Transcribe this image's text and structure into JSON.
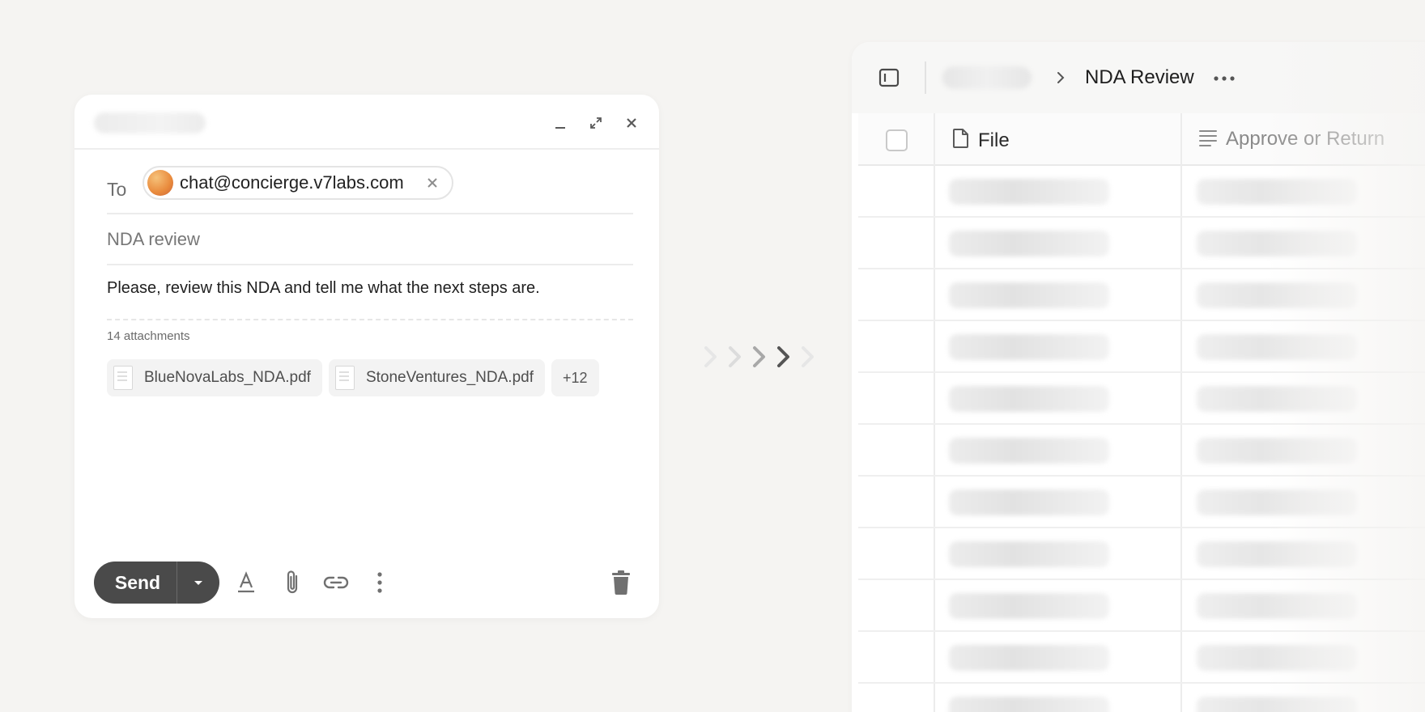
{
  "compose": {
    "to_label": "To",
    "recipient_email": "chat@concierge.v7labs.com",
    "subject": "NDA review",
    "body": "Please, review this NDA and tell me what the next steps are.",
    "attachments_count_label": "14 attachments",
    "attachments": [
      {
        "name": "BlueNovaLabs_NDA.pdf"
      },
      {
        "name": "StoneVentures_NDA.pdf"
      }
    ],
    "more_attachments": "+12",
    "send_label": "Send",
    "icons": {
      "minimize": "minimize-icon",
      "expand": "expand-icon",
      "close": "close-icon",
      "remove_recipient": "remove-recipient-icon",
      "formatting": "text-format-icon",
      "attach": "paperclip-icon",
      "link": "link-icon",
      "more": "more-vertical-icon",
      "discard": "trash-icon",
      "send_options": "caret-down-icon"
    }
  },
  "arrows": {
    "count": 5,
    "colors": [
      "#e6e6e6",
      "#dcdcdc",
      "#a8a8a8",
      "#555555",
      "#e6e6e6"
    ]
  },
  "table_panel": {
    "breadcrumb_title": "NDA Review",
    "columns": [
      {
        "label": "File",
        "icon": "file-icon"
      },
      {
        "label": "Approve or Return",
        "icon": "text-lines-icon"
      }
    ],
    "placeholder_row_count": 11,
    "icons": {
      "sidebar_toggle": "sidebar-toggle-icon",
      "breadcrumb_separator": "chevron-right-icon",
      "more": "more-horizontal-icon"
    }
  },
  "colors": {
    "background": "#f5f4f2",
    "send_button": "#4a4a4a"
  }
}
